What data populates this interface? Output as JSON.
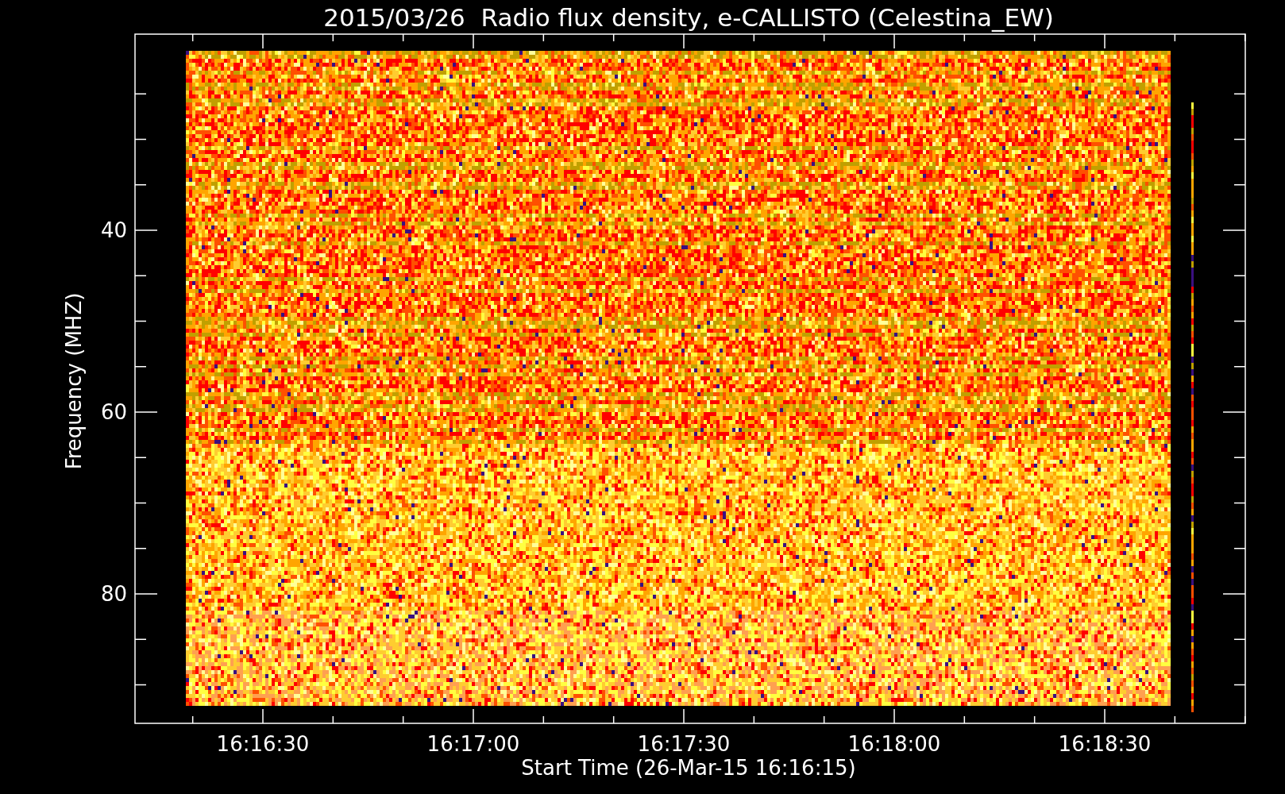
{
  "chart": {
    "title": "2015/03/26  Radio flux density, e-CALLISTO (Celestina_EW)",
    "ylabel": "Frequency (MHZ)",
    "xlabel": "Start Time (26-Mar-15 16:16:15)",
    "yticks": [
      "40",
      "60",
      "80"
    ],
    "xticks": [
      "16:16:30",
      "16:17:00",
      "16:17:30",
      "16:18:00",
      "16:18:30"
    ]
  }
}
